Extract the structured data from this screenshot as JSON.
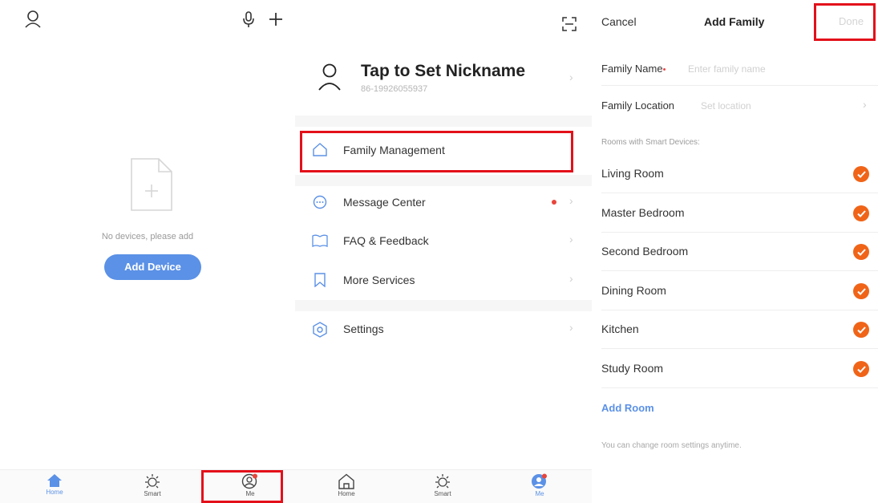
{
  "home": {
    "empty_text": "No devices, please add",
    "add_device_label": "Add Device",
    "tabbar": [
      {
        "label": "Home",
        "icon": "home-icon",
        "active": true
      },
      {
        "label": "Smart",
        "icon": "sun-icon",
        "active": false
      },
      {
        "label": "Me",
        "icon": "user-circle-icon",
        "active": false
      }
    ]
  },
  "me": {
    "nickname": "Tap to Set Nickname",
    "phone": "86-19926055937",
    "menu": [
      {
        "label": "Family Management",
        "icon": "house-outline-icon"
      },
      {
        "label": "Message Center",
        "icon": "chat-bubble-icon"
      },
      {
        "label": "FAQ & Feedback",
        "icon": "book-icon"
      },
      {
        "label": "More Services",
        "icon": "bookmark-icon"
      },
      {
        "label": "Settings",
        "icon": "hexagon-gear-icon"
      }
    ],
    "tabbar": [
      {
        "label": "Home",
        "icon": "home-outline-icon",
        "active": false
      },
      {
        "label": "Smart",
        "icon": "sun-icon",
        "active": false
      },
      {
        "label": "Me",
        "icon": "user-filled-icon",
        "active": true
      }
    ]
  },
  "add_family": {
    "cancel_label": "Cancel",
    "title": "Add Family",
    "done_label": "Done",
    "family_name_label": "Family Name",
    "family_name_required": "•",
    "family_name_placeholder": "Enter family name",
    "family_location_label": "Family Location",
    "family_location_placeholder": "Set location",
    "rooms_header": "Rooms with Smart Devices:",
    "rooms": [
      "Living Room",
      "Master Bedroom",
      "Second Bedroom",
      "Dining Room",
      "Kitchen",
      "Study Room"
    ],
    "add_room_label": "Add Room",
    "footnote": "You can change room settings anytime."
  },
  "colors": {
    "accent_blue": "#5b91e6",
    "check_orange": "#f06418",
    "highlight_red": "#e3101a",
    "notification_red": "#e8453c"
  }
}
